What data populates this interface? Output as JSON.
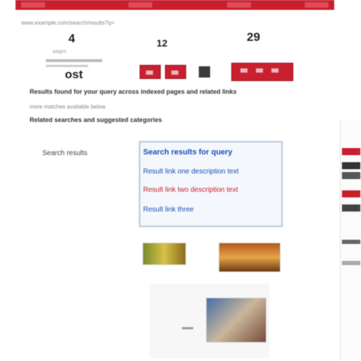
{
  "header": {
    "url_text": "www.example.com/search/results?q=",
    "stats": [
      {
        "value": "4",
        "label": "pages"
      },
      {
        "value": "12",
        "label": "links"
      },
      {
        "value": "29",
        "label": "images"
      }
    ],
    "mid_label": "ost"
  },
  "description": {
    "line1": "Results found for your query across indexed pages and related links",
    "line2": "more matches available below",
    "line3": "Related searches and suggested categories"
  },
  "sidebar": {
    "label": "Search results"
  },
  "results": {
    "title": "Search results for query",
    "items": [
      "Result link one description text",
      "Result link two description text",
      "Result link three"
    ]
  },
  "colors": {
    "brand_red": "#c81e2d",
    "link_blue": "#1a4fb5"
  }
}
